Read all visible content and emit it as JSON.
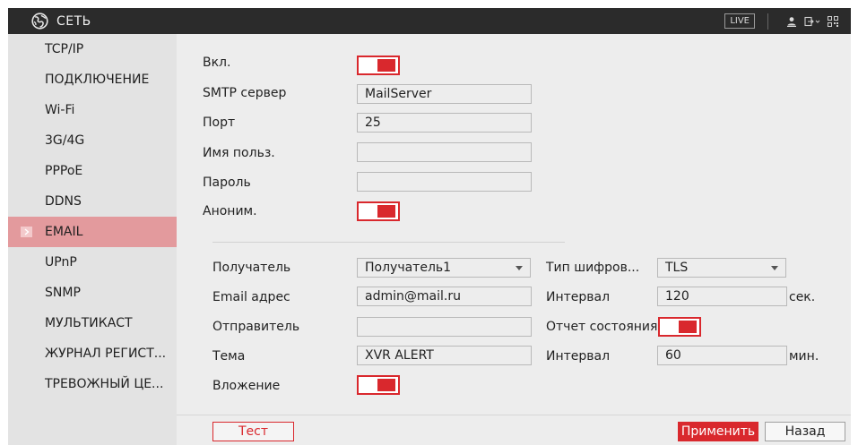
{
  "titlebar": {
    "title": "СЕТЬ",
    "live_label": "LIVE"
  },
  "sidebar": {
    "items": [
      {
        "label": "TCP/IP"
      },
      {
        "label": "ПОДКЛЮЧЕНИЕ"
      },
      {
        "label": "Wi-Fi"
      },
      {
        "label": "3G/4G"
      },
      {
        "label": "PPPoE"
      },
      {
        "label": "DDNS"
      },
      {
        "label": "EMAIL",
        "active": true
      },
      {
        "label": "UPnP"
      },
      {
        "label": "SNMP"
      },
      {
        "label": "МУЛЬТИКАСТ"
      },
      {
        "label": "ЖУРНАЛ РЕГИСТ..."
      },
      {
        "label": "ТРЕВОЖНЫЙ ЦЕ..."
      }
    ]
  },
  "email": {
    "enable_label": "Вкл.",
    "enable_on": true,
    "smtp_label": "SMTP сервер",
    "smtp_value": "MailServer",
    "port_label": "Порт",
    "port_value": "25",
    "user_label": "Имя польз.",
    "user_value": "",
    "password_label": "Пароль",
    "password_value": "",
    "anon_label": "Аноним.",
    "anon_on": true,
    "receiver_label": "Получатель",
    "receiver_value": "Получатель1",
    "email_label": "Email адрес",
    "email_value": "admin@mail.ru",
    "sender_label": "Отправитель",
    "sender_value": "",
    "subject_label": "Тема",
    "subject_value": "XVR ALERT",
    "attachment_label": "Вложение",
    "attachment_on": true,
    "encryption_label": "Тип шифров...",
    "encryption_value": "TLS",
    "interval1_label": "Интервал",
    "interval1_value": "120",
    "interval1_unit": "сек.",
    "health_label": "Отчет состояния",
    "health_on": true,
    "interval2_label": "Интервал",
    "interval2_value": "60",
    "interval2_unit": "мин."
  },
  "buttons": {
    "test_label": "Тест",
    "apply_label": "Применить",
    "back_label": "Назад"
  },
  "colors": {
    "accent": "#d9282d",
    "active_nav": "#e39a9d",
    "titlebar": "#2b2b2b"
  },
  "icons": {
    "logo": "network-globe-icon",
    "user": "user-icon",
    "logout": "logout-icon",
    "qr": "qr-code-icon",
    "nav_arrow": "chevron-right-icon"
  }
}
